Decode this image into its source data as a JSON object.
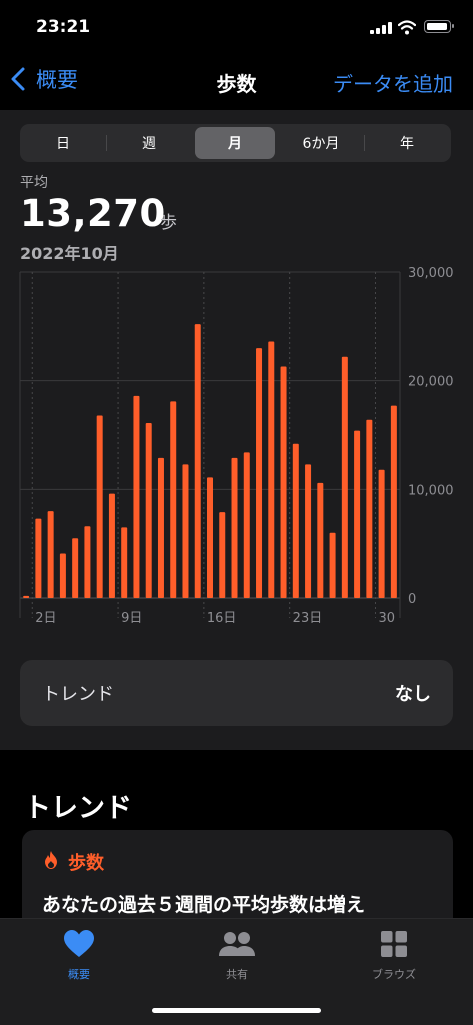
{
  "status_bar": {
    "time": "23:21"
  },
  "nav": {
    "back_label": "概要",
    "title": "歩数",
    "action_label": "データを追加"
  },
  "segments": [
    "日",
    "週",
    "月",
    "6か月",
    "年"
  ],
  "selected_segment": 2,
  "summary": {
    "label": "平均",
    "value": "13,270",
    "unit": "歩",
    "date_range": "2022年10月"
  },
  "chart_data": {
    "type": "bar",
    "x_tick_labels": [
      "2日",
      "9日",
      "16日",
      "23日",
      "30"
    ],
    "y_tick_labels": [
      "30,000",
      "20,000",
      "10,000",
      "0"
    ],
    "ylim": [
      0,
      30000
    ],
    "categories": [
      "1",
      "2",
      "3",
      "4",
      "5",
      "6",
      "7",
      "8",
      "9",
      "10",
      "11",
      "12",
      "13",
      "14",
      "15",
      "16",
      "17",
      "18",
      "19",
      "20",
      "21",
      "22",
      "23",
      "24",
      "25",
      "26",
      "27",
      "28",
      "29",
      "30",
      "31"
    ],
    "values": [
      200,
      7300,
      8000,
      4100,
      5500,
      6600,
      16800,
      9600,
      6500,
      18600,
      16100,
      12900,
      18100,
      12300,
      25200,
      11100,
      7900,
      12900,
      13400,
      23000,
      23600,
      21300,
      14200,
      12300,
      10600,
      6000,
      22200,
      15400,
      16400,
      11800,
      17700
    ],
    "bar_color": "#ff5e2a"
  },
  "trend_row": {
    "label": "トレンド",
    "value": "なし"
  },
  "trend_section": {
    "heading": "トレンド",
    "card_category": "歩数",
    "card_text": "あなたの過去５週間の平均歩数は増え"
  },
  "tab_bar": [
    {
      "label": "概要",
      "icon": "heart-icon",
      "active": true
    },
    {
      "label": "共有",
      "icon": "people-icon",
      "active": false
    },
    {
      "label": "ブラウズ",
      "icon": "grid-icon",
      "active": false
    }
  ],
  "colors": {
    "accent": "#3b8cf5",
    "steps": "#ff5e2a"
  }
}
